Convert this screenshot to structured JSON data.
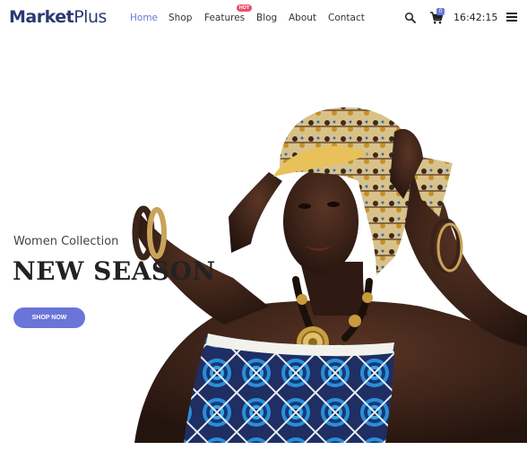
{
  "brand": {
    "part1": "Market",
    "part2": "Plus"
  },
  "nav": {
    "items": [
      {
        "label": "Home",
        "active": true
      },
      {
        "label": "Shop",
        "active": false
      },
      {
        "label": "Features",
        "active": false
      },
      {
        "label": "Blog",
        "active": false
      },
      {
        "label": "About",
        "active": false
      },
      {
        "label": "Contact",
        "active": false
      }
    ],
    "features_badge": "HOT"
  },
  "header": {
    "cart_count": "0",
    "clock": "16:42:15",
    "icons": {
      "search": "search-icon",
      "cart": "cart-icon",
      "menu": "hamburger-menu-icon"
    }
  },
  "hero": {
    "kicker": "Women Collection",
    "headline": "NEW SEASON",
    "button_label": "SHOP NOW"
  },
  "colors": {
    "accent": "#6a75d8",
    "brand": "#2b3a73",
    "hot_badge": "#e8506b"
  }
}
